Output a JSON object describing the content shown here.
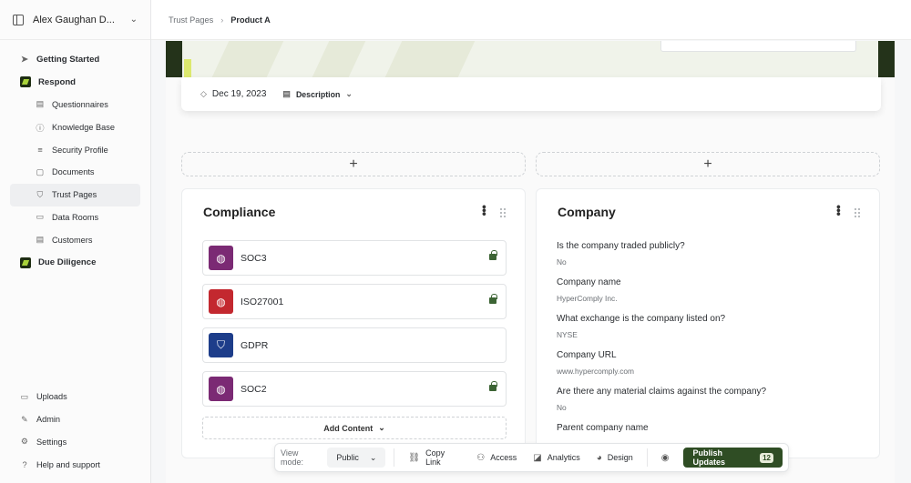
{
  "workspace": {
    "name": "Alex Gaughan D..."
  },
  "sidebar": {
    "getting_started": "Getting Started",
    "respond": "Respond",
    "items": [
      {
        "label": "Questionnaires",
        "icon": "document-icon"
      },
      {
        "label": "Knowledge Base",
        "icon": "info-circle-icon"
      },
      {
        "label": "Security Profile",
        "icon": "database-icon"
      },
      {
        "label": "Documents",
        "icon": "file-icon"
      },
      {
        "label": "Trust Pages",
        "icon": "shield-icon"
      },
      {
        "label": "Data Rooms",
        "icon": "folder-icon"
      },
      {
        "label": "Customers",
        "icon": "list-icon"
      }
    ],
    "due_diligence": "Due Diligence",
    "bottom": [
      {
        "label": "Uploads",
        "icon": "folder-icon"
      },
      {
        "label": "Admin",
        "icon": "wrench-icon"
      },
      {
        "label": "Settings",
        "icon": "gear-icon"
      },
      {
        "label": "Help and support",
        "icon": "help-icon"
      }
    ]
  },
  "breadcrumb": {
    "parent": "Trust Pages",
    "current": "Product A"
  },
  "header": {
    "date": "Dec 19, 2023",
    "description": "Description"
  },
  "compliance": {
    "title": "Compliance",
    "certs": [
      {
        "name": "SOC3",
        "locked": true
      },
      {
        "name": "ISO27001",
        "locked": true
      },
      {
        "name": "GDPR",
        "locked": false
      },
      {
        "name": "SOC2",
        "locked": true
      }
    ],
    "add_content": "Add Content"
  },
  "company": {
    "title": "Company",
    "fields": [
      {
        "q": "Is the company traded publicly?",
        "a": "No"
      },
      {
        "q": "Company name",
        "a": "HyperComply Inc."
      },
      {
        "q": "What exchange is the company listed on?",
        "a": "NYSE"
      },
      {
        "q": "Company URL",
        "a": "www.hypercomply.com"
      },
      {
        "q": "Are there any material claims against the company?",
        "a": "No"
      },
      {
        "q": "Parent company name",
        "a": ""
      }
    ]
  },
  "toolbar": {
    "view_mode_label": "View mode:",
    "view_mode_value": "Public",
    "copy_link": "Copy Link",
    "access": "Access",
    "analytics": "Analytics",
    "design": "Design",
    "publish": "Publish Updates",
    "publish_count": "12"
  },
  "colors": {
    "brand_dark": "#2f4d24",
    "brand_lime": "#a9d33a",
    "lock": "#3c6434"
  }
}
